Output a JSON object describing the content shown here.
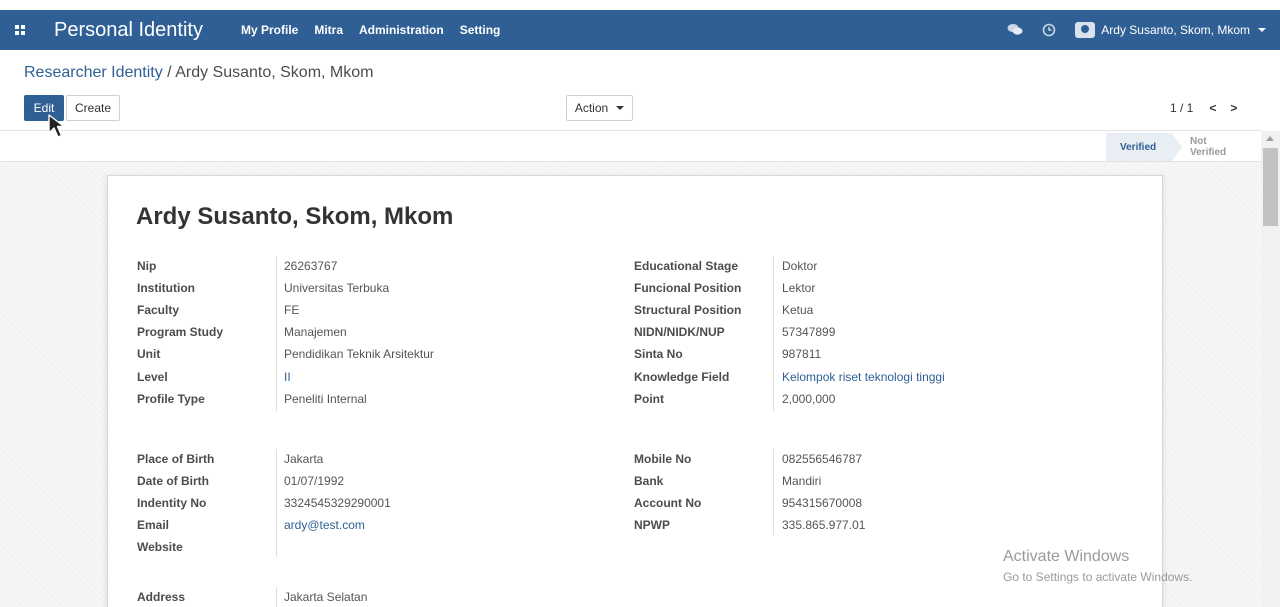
{
  "navbar": {
    "app_title": "Personal Identity",
    "menu": [
      "My Profile",
      "Mitra",
      "Administration",
      "Setting"
    ],
    "user_name": "Ardy Susanto, Skom, Mkom"
  },
  "breadcrumb": {
    "parent": "Researcher Identity",
    "separator": " / ",
    "current": "Ardy Susanto, Skom, Mkom"
  },
  "toolbar": {
    "edit_label": "Edit",
    "create_label": "Create",
    "action_label": "Action"
  },
  "pager": {
    "value": "1 / 1",
    "prev": "<",
    "next": ">"
  },
  "status": {
    "verified": "Verified",
    "not_verified": "Not Verified"
  },
  "record": {
    "title": "Ardy Susanto, Skom, Mkom",
    "left1": [
      {
        "label": "Nip",
        "value": "26263767"
      },
      {
        "label": "Institution",
        "value": "Universitas Terbuka"
      },
      {
        "label": "Faculty",
        "value": "FE"
      },
      {
        "label": "Program Study",
        "value": "Manajemen"
      },
      {
        "label": "Unit",
        "value": "Pendidikan Teknik Arsitektur"
      },
      {
        "label": "Level",
        "value": "II"
      },
      {
        "label": "Profile Type",
        "value": "Peneliti Internal"
      }
    ],
    "right1": [
      {
        "label": "Educational Stage",
        "value": "Doktor"
      },
      {
        "label": "Funcional Position",
        "value": "Lektor"
      },
      {
        "label": "Structural Position",
        "value": "Ketua"
      },
      {
        "label": "NIDN/NIDK/NUP",
        "value": "57347899"
      },
      {
        "label": "Sinta No",
        "value": "987811"
      },
      {
        "label": "Knowledge Field",
        "value": "Kelompok riset teknologi tinggi"
      },
      {
        "label": "Point",
        "value": "2,000,000"
      }
    ],
    "left2": [
      {
        "label": "Place of Birth",
        "value": "Jakarta"
      },
      {
        "label": "Date of Birth",
        "value": "01/07/1992"
      },
      {
        "label": "Indentity No",
        "value": "3324545329290001"
      },
      {
        "label": "Email",
        "value": "ardy@test.com"
      },
      {
        "label": "Website",
        "value": ""
      }
    ],
    "right2": [
      {
        "label": "Mobile No",
        "value": "082556546787"
      },
      {
        "label": "Bank",
        "value": "Mandiri"
      },
      {
        "label": "Account No",
        "value": "954315670008"
      },
      {
        "label": "NPWP",
        "value": "335.865.977.01"
      }
    ],
    "left3": [
      {
        "label": "Address",
        "value": "Jakarta Selatan"
      }
    ]
  },
  "watermark": {
    "line1": "Activate Windows",
    "line2": "Go to Settings to activate Windows."
  }
}
